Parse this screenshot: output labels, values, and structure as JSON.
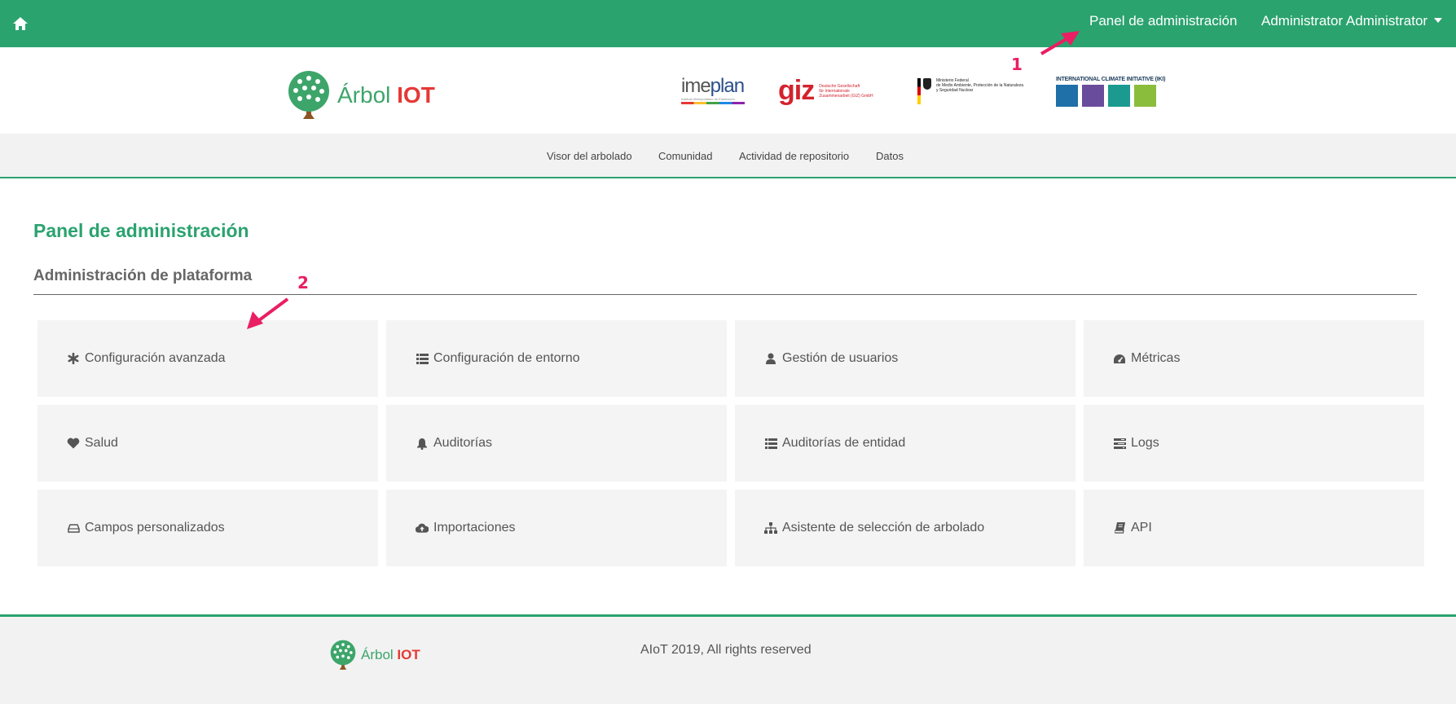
{
  "topbar": {
    "admin_panel_link": "Panel de administración",
    "user_menu": "Administrator Administrator",
    "bg_color": "#2ba36f"
  },
  "brand": {
    "name_part1": "Árbol",
    "name_part2": "IOT"
  },
  "partners": {
    "imeplan": {
      "main": "ime",
      "accent": "plan",
      "subtitle": "Instituto Metropolitano de Planeación"
    },
    "giz": {
      "logo": "giz",
      "line1": "Deutsche Gesellschaft",
      "line2": "für Internationale",
      "line3": "Zusammenarbeit (GIZ) GmbH"
    },
    "bmu": {
      "line1": "Ministerio Federal",
      "line2": "de Medio Ambiente, Protección de la Naturaleza",
      "line3": "y Seguridad Nuclear"
    },
    "iki": {
      "title": "INTERNATIONAL CLIMATE INITIATIVE (IKI)"
    }
  },
  "nav": {
    "items": [
      "Visor del arbolado",
      "Comunidad",
      "Actividad de repositorio",
      "Datos"
    ]
  },
  "page": {
    "title": "Panel de administración",
    "section": "Administración de plataforma"
  },
  "cards": [
    {
      "label": "Configuración avanzada",
      "icon": "asterisk-icon"
    },
    {
      "label": "Configuración de entorno",
      "icon": "list-icon"
    },
    {
      "label": "Gestión de usuarios",
      "icon": "user-icon"
    },
    {
      "label": "Métricas",
      "icon": "tachometer-icon"
    },
    {
      "label": "Salud",
      "icon": "heart-icon"
    },
    {
      "label": "Auditorías",
      "icon": "bell-icon"
    },
    {
      "label": "Auditorías de entidad",
      "icon": "list-icon"
    },
    {
      "label": "Logs",
      "icon": "tasks-icon"
    },
    {
      "label": "Campos personalizados",
      "icon": "hdd-icon"
    },
    {
      "label": "Importaciones",
      "icon": "cloud-upload-icon"
    },
    {
      "label": "Asistente de selección de arbolado",
      "icon": "sitemap-icon"
    },
    {
      "label": "API",
      "icon": "book-icon"
    }
  ],
  "footer": {
    "copyright": "AIoT 2019, All rights reserved"
  },
  "annotations": {
    "n1": "1",
    "n2": "2",
    "color": "#e91e63"
  }
}
